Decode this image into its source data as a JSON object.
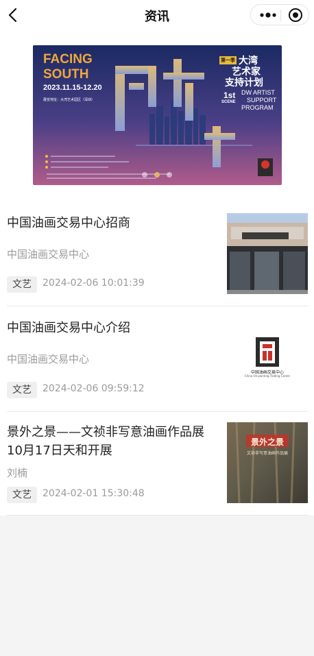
{
  "header": {
    "title": "资讯"
  },
  "banner": {
    "facing": "FACING",
    "south": "SOUTH",
    "dates": "2023.11.15-12.20",
    "title_cn_1": "大湾",
    "title_cn_2": "艺术家",
    "title_cn_3": "支持计划",
    "season": "第一季",
    "scene_num": "1st",
    "scene_word": "SCENE",
    "en_1": "DW ARTIST",
    "en_2": "SUPPORT",
    "en_3": "PROGRAM",
    "big_chars": "向南方",
    "venue": "展览地址：大湾艺术园区（深圳）"
  },
  "news": [
    {
      "title": "中国油画交易中心招商",
      "source": "中国油画交易中心",
      "tag": "文艺",
      "date": "2024-02-06 10:01:39"
    },
    {
      "title": "中国油画交易中心介绍",
      "source": "中国油画交易中心",
      "tag": "文艺",
      "date": "2024-02-06 09:59:12",
      "logo_text": "中国油画交易中心",
      "logo_sub": "China Oil painting Trading Center"
    },
    {
      "title": "景外之景——文祯非写意油画作品展10月17日天和开展",
      "source": "刘楠",
      "tag": "文艺",
      "date": "2024-02-01 15:30:48",
      "poster_text": "景外之景",
      "poster_sub": "文祯非写意油画作品展"
    }
  ]
}
